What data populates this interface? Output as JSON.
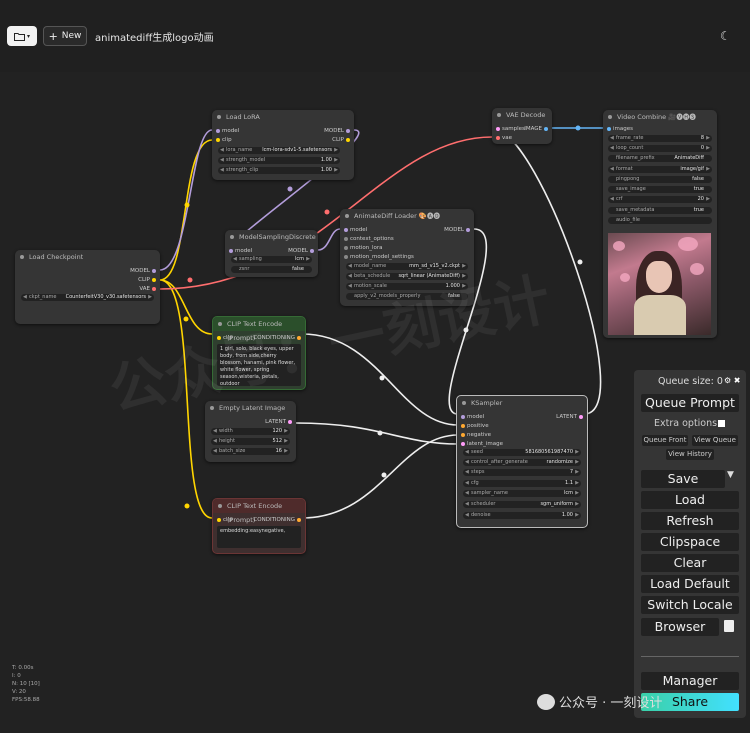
{
  "topbar": {
    "workflow_title": "animatediff生成logo动画",
    "new_label": "New"
  },
  "nodes": {
    "load_lora": {
      "title": "Load LoRA",
      "in_model": "model",
      "in_clip": "clip",
      "out_model": "MODEL",
      "out_clip": "CLIP",
      "widgets": [
        {
          "n": "lora_name",
          "v": "lcm-lora-sdv1-5.safetensors"
        },
        {
          "n": "strength_model",
          "v": "1.00"
        },
        {
          "n": "strength_clip",
          "v": "1.00"
        }
      ]
    },
    "model_sampling": {
      "title": "ModelSamplingDiscrete",
      "in_model": "model",
      "out_model": "MODEL",
      "widgets": [
        {
          "n": "sampling",
          "v": "lcm"
        },
        {
          "n": "zsnr",
          "v": "false"
        }
      ]
    },
    "load_checkpoint": {
      "title": "Load Checkpoint",
      "out_model": "MODEL",
      "out_clip": "CLIP",
      "out_vae": "VAE",
      "widgets": [
        {
          "n": "ckpt_name",
          "v": "CounterfeitV30_v30.safetensors"
        }
      ]
    },
    "animatediff_loader": {
      "title": "AnimateDiff Loader 🎨🅐🅓",
      "in_model": "model",
      "in_context": "context_options",
      "in_motion_lora": "motion_lora",
      "in_motion_settings": "motion_model_settings",
      "out_model": "MODEL",
      "widgets": [
        {
          "n": "model_name",
          "v": "mm_sd_v15_v2.ckpt"
        },
        {
          "n": "beta_schedule",
          "v": "sqrt_linear (AnimateDiff)"
        },
        {
          "n": "motion_scale",
          "v": "1.000"
        },
        {
          "n": "apply_v2_models_properly",
          "v": "false"
        }
      ]
    },
    "vae_decode": {
      "title": "VAE Decode",
      "in_samples": "samples",
      "in_vae": "vae",
      "out_image": "IMAGE"
    },
    "video_combine": {
      "title": "Video Combine 🎥🅥🅗🅢",
      "in_images": "images",
      "widgets": [
        {
          "n": "frame_rate",
          "v": "8"
        },
        {
          "n": "loop_count",
          "v": "0"
        },
        {
          "n": "filename_prefix",
          "v": "AnimateDiff"
        },
        {
          "n": "format",
          "v": "image/gif"
        },
        {
          "n": "pingpong",
          "v": "false"
        },
        {
          "n": "save_image",
          "v": "true"
        },
        {
          "n": "crf",
          "v": "20"
        },
        {
          "n": "save_metadata",
          "v": "true"
        },
        {
          "n": "audio_file",
          "v": ""
        }
      ]
    },
    "clip_pos": {
      "title": "CLIP Text Encode (Prompt)",
      "in_clip": "clip",
      "out_cond": "CONDITIONING",
      "text": "1 girl, solo, black eyes, upper body, from side,cherry blossom, hanami, pink flower, white flower, spring season,wisteria, petals, outdoor"
    },
    "empty_latent": {
      "title": "Empty Latent Image",
      "out_latent": "LATENT",
      "widgets": [
        {
          "n": "width",
          "v": "120"
        },
        {
          "n": "height",
          "v": "512"
        },
        {
          "n": "batch_size",
          "v": "16"
        }
      ]
    },
    "clip_neg": {
      "title": "CLIP Text Encode (Prompt)",
      "in_clip": "clip",
      "out_cond": "CONDITIONING",
      "text": "embedding:easynegative,"
    },
    "ksampler": {
      "title": "KSampler",
      "in_model": "model",
      "in_positive": "positive",
      "in_negative": "negative",
      "in_latent": "latent_image",
      "out_latent": "LATENT",
      "widgets": [
        {
          "n": "seed",
          "v": "581680561987470"
        },
        {
          "n": "control_after_generate",
          "v": "randomize"
        },
        {
          "n": "steps",
          "v": "7"
        },
        {
          "n": "cfg",
          "v": "1.1"
        },
        {
          "n": "sampler_name",
          "v": "lcm"
        },
        {
          "n": "scheduler",
          "v": "sgm_uniform"
        },
        {
          "n": "denoise",
          "v": "1.00"
        }
      ]
    }
  },
  "menu": {
    "queue_size": "Queue size: 0",
    "queue_prompt": "Queue Prompt",
    "extra_options": "Extra options",
    "queue_front": "Queue Front",
    "view_queue": "View Queue",
    "view_history": "View History",
    "save": "Save",
    "load": "Load",
    "refresh": "Refresh",
    "clipspace": "Clipspace",
    "clear": "Clear",
    "load_default": "Load Default",
    "switch_locale": "Switch Locale",
    "browser": "Browser",
    "manager": "Manager",
    "share": "Share"
  },
  "stats": [
    "T: 0.00s",
    "I: 0",
    "N: 10 [10]",
    "V: 20",
    "FPS:58.88"
  ],
  "watermark": "公众号：一刻设计",
  "wechat_label": "公众号 · 一刻设计",
  "colors": {
    "model_link": "#b39ddb",
    "clip_link": "#ffd500",
    "vae_link": "#ff6e6e",
    "image_link": "#64b5f6",
    "cond_link": "#ffa931",
    "latent_link": "#ff9cf9",
    "white_link": "#ffffff"
  }
}
